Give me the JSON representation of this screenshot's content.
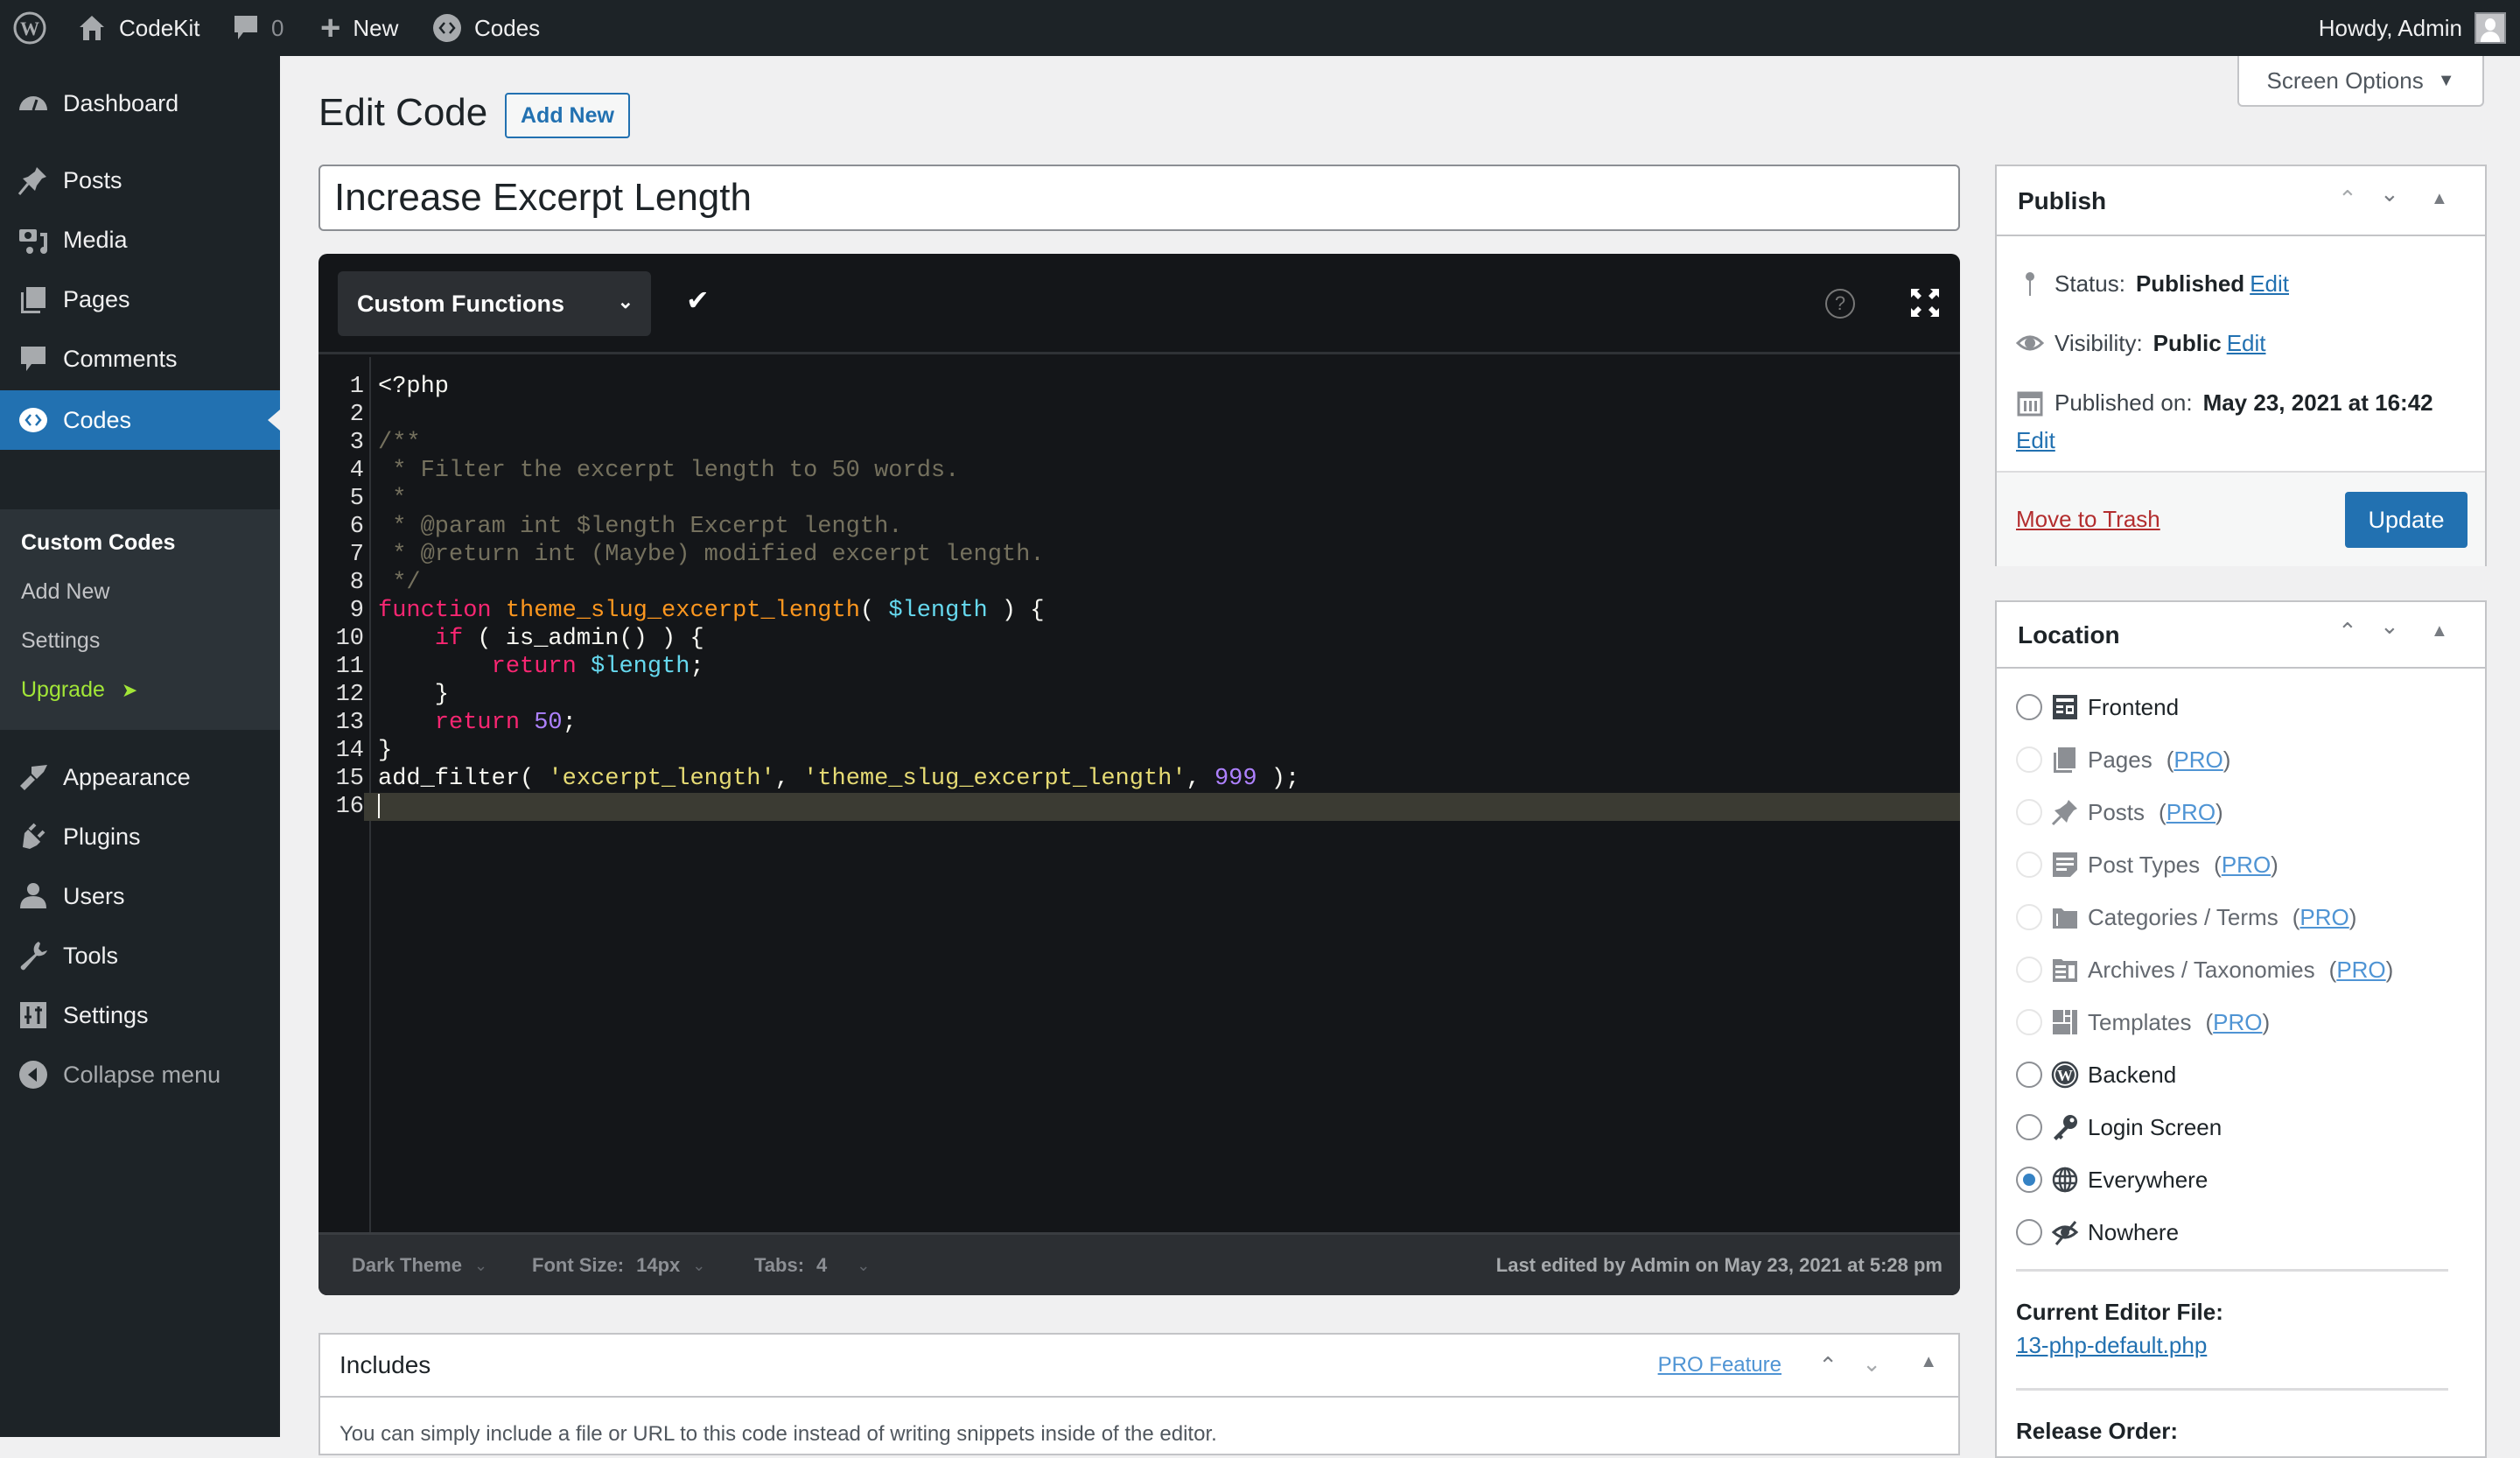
{
  "adminbar": {
    "site_name": "CodeKit",
    "comments_count": "0",
    "new_label": "New",
    "codes_label": "Codes",
    "greeting": "Howdy, Admin"
  },
  "sidebar": {
    "items": [
      {
        "label": "Dashboard",
        "icon": "dashboard-icon"
      },
      {
        "label": "Posts",
        "icon": "pin-icon"
      },
      {
        "label": "Media",
        "icon": "media-icon"
      },
      {
        "label": "Pages",
        "icon": "pages-icon"
      },
      {
        "label": "Comments",
        "icon": "comment-icon"
      },
      {
        "label": "Codes",
        "icon": "code-icon",
        "active": true
      },
      {
        "label": "Appearance",
        "icon": "brush-icon"
      },
      {
        "label": "Plugins",
        "icon": "plug-icon"
      },
      {
        "label": "Users",
        "icon": "user-icon"
      },
      {
        "label": "Tools",
        "icon": "wrench-icon"
      },
      {
        "label": "Settings",
        "icon": "sliders-icon"
      },
      {
        "label": "Collapse menu",
        "icon": "collapse-icon"
      }
    ],
    "submenu": [
      {
        "label": "Custom Codes",
        "current": true
      },
      {
        "label": "Add New"
      },
      {
        "label": "Settings"
      },
      {
        "label": "Upgrade",
        "suffix": "➤"
      }
    ]
  },
  "header": {
    "title": "Edit Code",
    "add_new_label": "Add New",
    "screen_options_label": "Screen Options",
    "screen_options_arrow": "▼"
  },
  "post_title": "Increase Excerpt Length",
  "editor": {
    "code_type": "Custom Functions",
    "check_glyph": "✔",
    "help_glyph": "?",
    "lines": [
      [
        {
          "t": "plain",
          "v": "<?php"
        }
      ],
      [],
      [
        {
          "t": "comment",
          "v": "/**"
        }
      ],
      [
        {
          "t": "comment",
          "v": " * Filter the excerpt length to 50 words."
        }
      ],
      [
        {
          "t": "comment",
          "v": " *"
        }
      ],
      [
        {
          "t": "comment",
          "v": " * @param int $length Excerpt length."
        }
      ],
      [
        {
          "t": "comment",
          "v": " * @return int (Maybe) modified excerpt length."
        }
      ],
      [
        {
          "t": "comment",
          "v": " */"
        }
      ],
      [
        {
          "t": "keyword",
          "v": "function"
        },
        {
          "t": "plain",
          "v": " "
        },
        {
          "t": "function",
          "v": "theme_slug_excerpt_length"
        },
        {
          "t": "plain",
          "v": "( "
        },
        {
          "t": "variable",
          "v": "$length"
        },
        {
          "t": "plain",
          "v": " ) {"
        }
      ],
      [
        {
          "t": "plain",
          "v": "    "
        },
        {
          "t": "keyword",
          "v": "if"
        },
        {
          "t": "plain",
          "v": " ( is_admin() ) {"
        }
      ],
      [
        {
          "t": "plain",
          "v": "        "
        },
        {
          "t": "keyword",
          "v": "return"
        },
        {
          "t": "plain",
          "v": " "
        },
        {
          "t": "variable",
          "v": "$length"
        },
        {
          "t": "plain",
          "v": ";"
        }
      ],
      [
        {
          "t": "plain",
          "v": "    }"
        }
      ],
      [
        {
          "t": "plain",
          "v": "    "
        },
        {
          "t": "keyword",
          "v": "return"
        },
        {
          "t": "plain",
          "v": " "
        },
        {
          "t": "number",
          "v": "50"
        },
        {
          "t": "plain",
          "v": ";"
        }
      ],
      [
        {
          "t": "plain",
          "v": "}"
        }
      ],
      [
        {
          "t": "plain",
          "v": "add_filter( "
        },
        {
          "t": "string",
          "v": "'excerpt_length'"
        },
        {
          "t": "plain",
          "v": ", "
        },
        {
          "t": "string",
          "v": "'theme_slug_excerpt_length'"
        },
        {
          "t": "plain",
          "v": ", "
        },
        {
          "t": "number",
          "v": "999"
        },
        {
          "t": "plain",
          "v": " );"
        }
      ],
      []
    ],
    "active_line": 16,
    "footer": {
      "theme": "Dark Theme",
      "font_size_label": "Font Size:",
      "font_size_value": "14px",
      "tabs_label": "Tabs:",
      "tabs_value": "4",
      "last_edited": "Last edited by Admin on May 23, 2021 at 5:28 pm"
    }
  },
  "includes": {
    "title": "Includes",
    "pro_label": "PRO Feature",
    "description": "You can simply include a file or URL to this code instead of writing snippets inside of the editor."
  },
  "publish": {
    "title": "Publish",
    "status_label": "Status:",
    "status_value": "Published",
    "visibility_label": "Visibility:",
    "visibility_value": "Public",
    "published_on_label": "Published on:",
    "published_on_value": "May 23, 2021 at 16:42",
    "edit_label": "Edit",
    "trash_label": "Move to Trash",
    "update_label": "Update"
  },
  "location": {
    "title": "Location",
    "options": [
      {
        "label": "Frontend",
        "icon": "layout-icon",
        "pro": false,
        "checked": false
      },
      {
        "label": "Pages",
        "icon": "pages-icon",
        "pro": true,
        "checked": false
      },
      {
        "label": "Posts",
        "icon": "pin-icon",
        "pro": true,
        "checked": false
      },
      {
        "label": "Post Types",
        "icon": "post-types-icon",
        "pro": true,
        "checked": false
      },
      {
        "label": "Categories / Terms",
        "icon": "folder-icon",
        "pro": true,
        "checked": false
      },
      {
        "label": "Archives / Taxonomies",
        "icon": "archive-icon",
        "pro": true,
        "checked": false
      },
      {
        "label": "Templates",
        "icon": "templates-icon",
        "pro": true,
        "checked": false
      },
      {
        "label": "Backend",
        "icon": "wordpress-icon",
        "pro": false,
        "checked": false
      },
      {
        "label": "Login Screen",
        "icon": "key-icon",
        "pro": false,
        "checked": false
      },
      {
        "label": "Everywhere",
        "icon": "globe-icon",
        "pro": false,
        "checked": true
      },
      {
        "label": "Nowhere",
        "icon": "hidden-icon",
        "pro": false,
        "checked": false
      }
    ],
    "pro_label": "PRO",
    "current_file_label": "Current Editor File:",
    "current_file_value": "13-php-default.php",
    "release_order_label": "Release Order:"
  },
  "colors": {
    "accent": "#2271b1",
    "admin_dark": "#1d2327",
    "editor_bg": "#141619",
    "trash_red": "#b32d2e",
    "upgrade_green": "#a2e637"
  }
}
